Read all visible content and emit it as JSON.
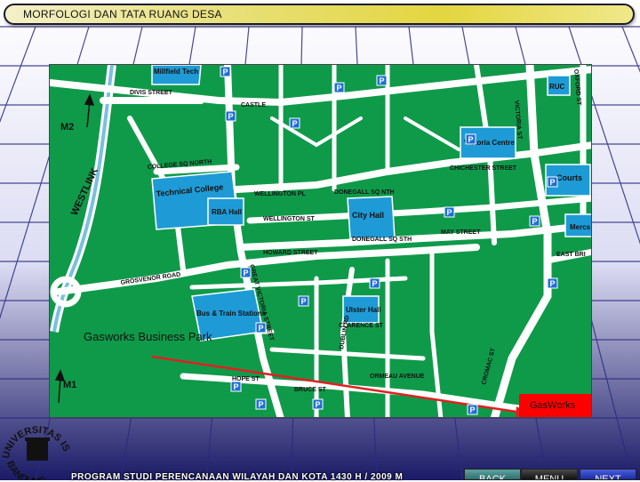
{
  "slide": {
    "title": "MORFOLOGI DAN TATA RUANG DESA",
    "footer": "PROGRAM STUDI PERENCANAAN WILAYAH DAN KOTA  1430 H / 2009 M"
  },
  "nav": {
    "back": "BACK",
    "menu": "MENU",
    "next": "NEXT"
  },
  "logo": {
    "text": "UNIVERSITAS ISLAM BANDUNG"
  },
  "map": {
    "colors": {
      "land": "#0f9a4a",
      "road": "#ffffff",
      "building": "#1e9bd6",
      "route": "#e02020",
      "destination": "#ff0000"
    },
    "places": {
      "millfield_tech": "Millfield Tech",
      "technical_college": "Technical College",
      "rba_hall": "RBA Hall",
      "city_hall": "City Hall",
      "victoria_centre": "Victoria Centre",
      "courts": "Courts",
      "mercs": "Mercs",
      "ruc": "RUC",
      "bus_train": "Bus & Train Stations",
      "ulster_hall": "Ulster Hall",
      "gasworks_park": "Gasworks Business Park",
      "gasworks": "GasWorks"
    },
    "streets": {
      "divis": "DIVIS STREET",
      "castle": "CASTLE",
      "college_sq_north": "COLLEGE SQ NORTH",
      "wellington_pl": "WELLINGTON PL",
      "wellington_st": "WELLINGTON ST",
      "donegall_sq_nth": "DONEGALL SQ NTH",
      "donegall_sq_sth": "DONEGALL SQ STH",
      "howard": "HOWARD STREET",
      "grosvenor": "GROSVENOR ROAD",
      "may": "MAY STREET",
      "chichester": "CHICHESTER STREET",
      "victoria": "VICTORIA ST",
      "oxford": "OXFORD ST",
      "great_victoria": "GREAT VICTORIA STREET",
      "hope": "HOPE ST",
      "bruce": "BRUCE ST",
      "dublin_rd": "DUBLIN RD",
      "ormeau": "ORMEAU AVENUE",
      "cromac": "CROMAC ST",
      "westlink": "WESTLINK",
      "m1": "M1",
      "m2": "M2",
      "east_bridge": "EAST BRI",
      "clarence": "CLARENCE ST"
    },
    "parking_label": "P"
  }
}
